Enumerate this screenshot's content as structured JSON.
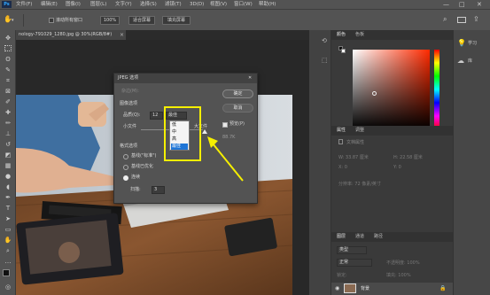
{
  "menubar": {
    "logo": "Ps",
    "items": [
      "文件(F)",
      "编辑(E)",
      "图像(I)",
      "图层(L)",
      "文字(Y)",
      "选择(S)",
      "滤镜(T)",
      "3D(D)",
      "视图(V)",
      "窗口(W)",
      "帮助(H)"
    ],
    "win_min": "—",
    "win_max": "□",
    "win_close": "✕"
  },
  "optbar": {
    "scroll_all": "滚动所有窗口",
    "zoom": "100%",
    "fit_screen": "适合屏幕",
    "fill_screen": "填充屏幕"
  },
  "doctab": {
    "label": "nology-791029_1280.jpg @ 30%(RGB/8#)"
  },
  "dialog": {
    "title": "JPEG 选项",
    "close": "✕",
    "matte_label": "杂边(M):",
    "image_options": "图像选项",
    "quality_label": "品质(Q):",
    "quality_value": "12",
    "quality_select": "最佳",
    "small_file": "小文件",
    "large_file": "大文件",
    "format_options": "格式选项",
    "baseline_standard": "基线(\"标准\")",
    "baseline_optimized": "基线已优化",
    "progressive": "连续",
    "scans_label": "扫描:",
    "scans_value": "3",
    "ok": "确定",
    "cancel": "取消",
    "preview": "预览(P)",
    "filesize": "88.7K"
  },
  "dropdown": {
    "options": [
      "低",
      "中",
      "高",
      "最佳"
    ],
    "selected": "最佳"
  },
  "panels": {
    "color_tabs": [
      "颜色",
      "色板"
    ],
    "props_tabs": [
      "属性",
      "调整"
    ],
    "props_subtitle": "文档属性",
    "props_w": "W: 33.87 厘米",
    "props_h": "H: 22.58 厘米",
    "props_x": "X: 0",
    "props_y": "Y: 0",
    "props_res": "分辨率: 72 像素/英寸",
    "layers_tabs": [
      "图层",
      "通道",
      "路径"
    ],
    "layer_kind": "类型",
    "layer_normal": "正常",
    "layer_opacity": "不透明度: 100%",
    "layer_lock": "锁定:",
    "layer_fill": "填充: 100%",
    "layer_name": "背景"
  },
  "rightdock": {
    "learn": "学习",
    "libraries": "库"
  },
  "colors": {
    "highlight": "#f5ef00",
    "selected": "#1e75d6"
  }
}
